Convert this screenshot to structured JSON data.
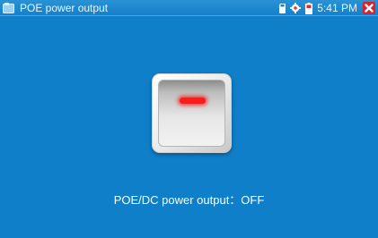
{
  "window": {
    "title": "POE power output"
  },
  "status_bar": {
    "time": "5:41 PM",
    "icons": [
      "sd-card-icon",
      "settings-icon",
      "battery-icon",
      "close-icon"
    ]
  },
  "main": {
    "switch_state": "OFF",
    "status_text": "POE/DC power output：OFF"
  },
  "colors": {
    "background": "#0f7fc9",
    "indicator": "#ff1a1a",
    "close": "#d8232a"
  }
}
